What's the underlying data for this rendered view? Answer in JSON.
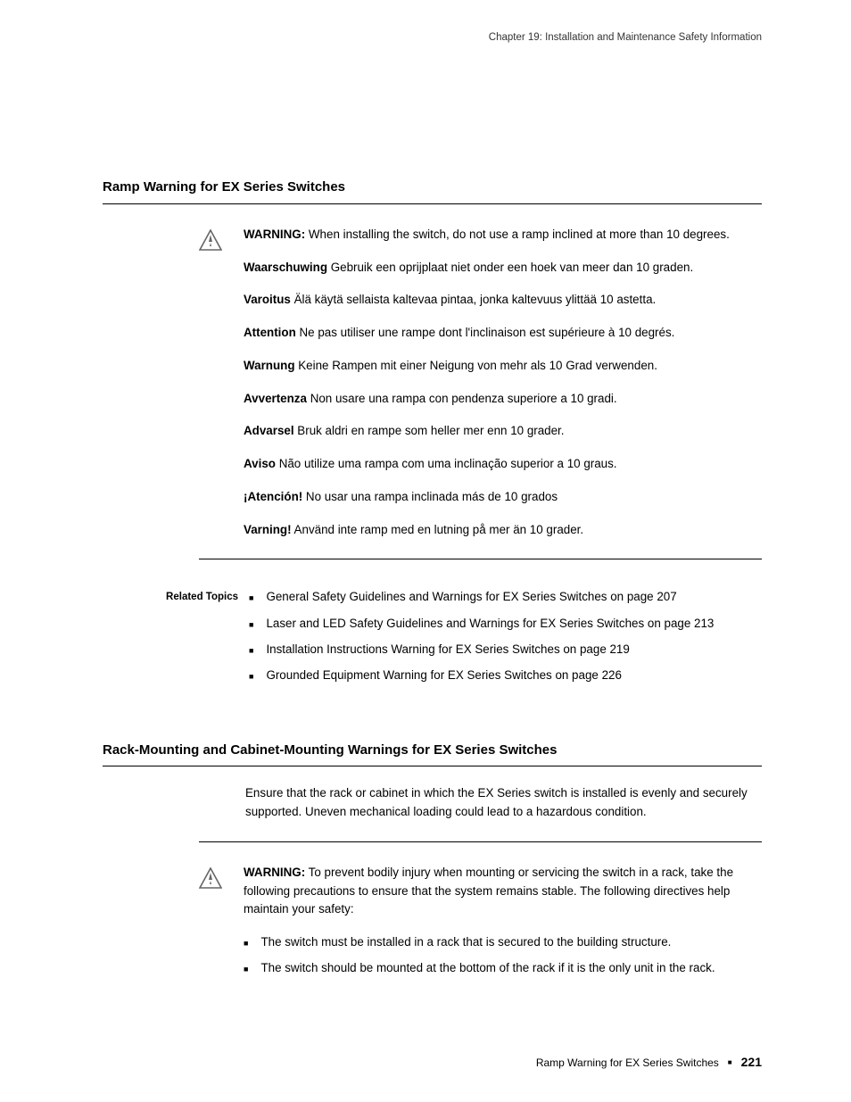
{
  "header": {
    "running": "Chapter 19: Installation and Maintenance Safety Information"
  },
  "section1": {
    "heading": "Ramp Warning for EX Series Switches",
    "warn": {
      "p1_bold": "WARNING:",
      "p1_rest": " When installing the switch, do not use a ramp inclined at more than 10 degrees.",
      "p2_bold": "Waarschuwing",
      "p2_rest": " Gebruik een oprijplaat niet onder een hoek van meer dan 10 graden.",
      "p3_bold": "Varoitus",
      "p3_rest": " Älä käytä sellaista kaltevaa pintaa, jonka kaltevuus ylittää 10 astetta.",
      "p4_bold": "Attention",
      "p4_rest": " Ne pas utiliser une rampe dont l'inclinaison est supérieure à 10 degrés.",
      "p5_bold": "Warnung",
      "p5_rest": " Keine Rampen mit einer Neigung von mehr als 10 Grad verwenden.",
      "p6_bold": "Avvertenza",
      "p6_rest": " Non usare una rampa con pendenza superiore a 10 gradi.",
      "p7_bold": "Advarsel",
      "p7_rest": " Bruk aldri en rampe som heller mer enn 10 grader.",
      "p8_bold": "Aviso",
      "p8_rest": " Não utilize uma rampa com uma inclinação superior a 10 graus.",
      "p9_bold": "¡Atención!",
      "p9_rest": " No usar una rampa inclinada más de 10 grados",
      "p10_bold": "Varning!",
      "p10_rest": " Använd inte ramp med en lutning på mer än 10 grader."
    }
  },
  "related": {
    "label": "Related Topics",
    "items": [
      "General Safety Guidelines and Warnings for EX Series Switches on page 207",
      "Laser and LED Safety Guidelines and Warnings for EX Series Switches on page 213",
      "Installation Instructions Warning for EX Series Switches on page 219",
      "Grounded Equipment Warning for EX Series Switches on page 226"
    ]
  },
  "section2": {
    "heading": "Rack-Mounting and Cabinet-Mounting Warnings for EX Series Switches",
    "intro": "Ensure that the rack or cabinet in which the EX Series switch is installed is evenly and securely supported. Uneven mechanical loading could lead to a hazardous condition.",
    "warn": {
      "p1_bold": "WARNING:",
      "p1_rest": " To prevent bodily injury when mounting or servicing the switch in a rack, take the following precautions to ensure that the system remains stable. The following directives help maintain your safety:",
      "items": [
        "The switch must be installed in a rack that is secured to the building structure.",
        "The switch should be mounted at the bottom of the rack if it is the only unit in the rack."
      ]
    }
  },
  "footer": {
    "text": "Ramp Warning for EX Series Switches",
    "page": "221"
  }
}
